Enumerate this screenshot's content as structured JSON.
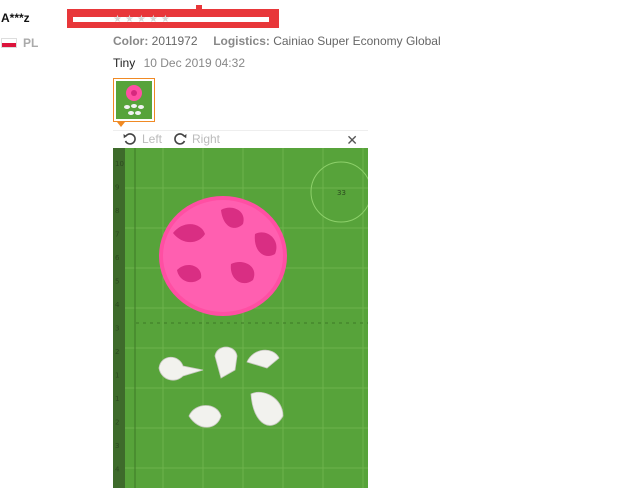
{
  "reviewer": {
    "name": "A***z",
    "country": "PL"
  },
  "rating_stars": "★★★★★",
  "order": {
    "color_label": "Color:",
    "color_value": "2011972",
    "logistics_label": "Logistics:",
    "logistics_value": "Cainiao Super Economy Global"
  },
  "review": {
    "text": "Tiny",
    "date": "10 Dec 2019 04:32"
  },
  "viewer": {
    "rotate_left_label": "Left",
    "rotate_right_label": "Right",
    "close_glyph": "✕"
  },
  "photo": {
    "ruler_numbers": [
      "10",
      "9",
      "8",
      "7",
      "6",
      "5",
      "4",
      "3",
      "2",
      "1",
      "1",
      "2",
      "3",
      "4"
    ],
    "circle_label": "33"
  },
  "colors": {
    "accent_orange": "#f08a24",
    "redaction_red": "#e8373a",
    "mat_green": "#57a33a",
    "mold_pink": "#ff4fa3"
  }
}
